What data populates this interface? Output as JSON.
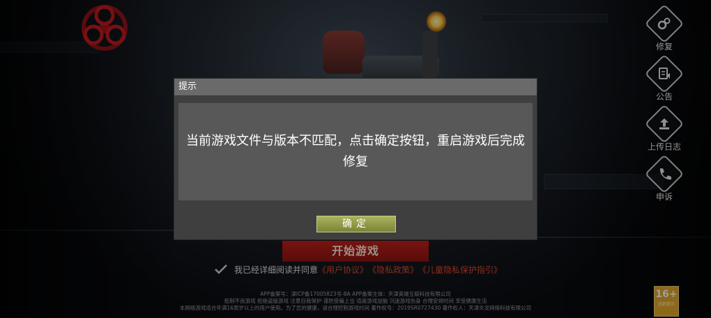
{
  "side_menu": [
    {
      "label": "修复",
      "icon": "gears-icon"
    },
    {
      "label": "公告",
      "icon": "announcement-icon"
    },
    {
      "label": "上传日志",
      "icon": "upload-log-icon"
    },
    {
      "label": "申诉",
      "icon": "appeal-phone-icon"
    }
  ],
  "start_button": "开始游戏",
  "agreement": {
    "prefix": "我已经详细阅读并同意",
    "links": [
      "《用户协议》",
      "《隐私政策》",
      "《儿童隐私保护指引》"
    ]
  },
  "footer": {
    "line1": "APP备案号：津ICP备17005823号-8A  APP备案主体：天津英雄互娱科技有限公司",
    "line2": "抵制不良游戏 拒绝盗版游戏 注意自我保护 谨防受骗上当 适度游戏益脑 沉迷游戏伤身 合理安排时间 享受健康生活",
    "line3": "本网络游戏适合年满16周岁以上的用户使用。为了您的健康，请合理控制游戏时间   著作权号：2019SR0727430   著作权人：天津炎龙网络科技有限公司"
  },
  "age_rating": {
    "number": "16+",
    "label": "适龄提示"
  },
  "dialog": {
    "title": "提示",
    "message": "当前游戏文件与版本不匹配，点击确定按钮，重启游戏后完成修复",
    "ok_label": "确定"
  },
  "colors": {
    "brand_red": "#c21f1a",
    "link_red": "#e04a2e",
    "ok_green": "#9aa54c"
  }
}
